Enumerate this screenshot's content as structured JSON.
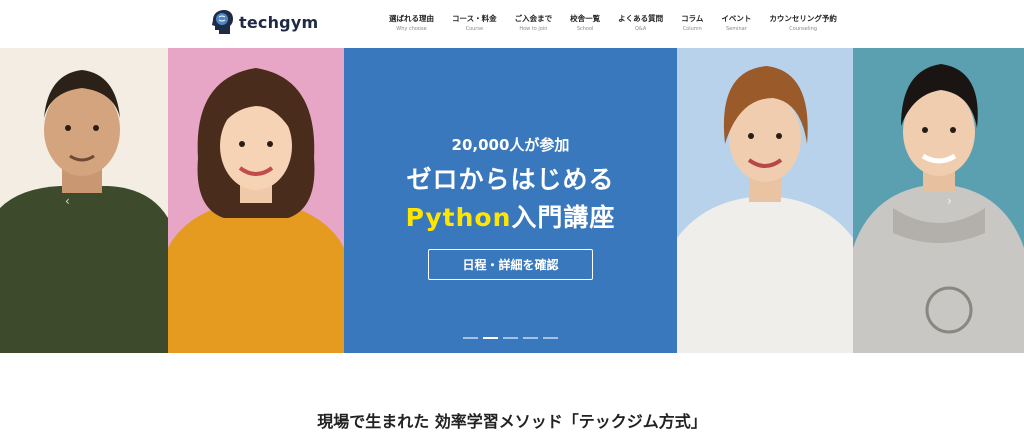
{
  "header": {
    "logo_text": "techgym",
    "nav": [
      {
        "jp": "選ばれる理由",
        "en": "Why choose"
      },
      {
        "jp": "コース・料金",
        "en": "Course"
      },
      {
        "jp": "ご入会まで",
        "en": "How to join"
      },
      {
        "jp": "校舎一覧",
        "en": "School"
      },
      {
        "jp": "よくある質問",
        "en": "Q&A"
      },
      {
        "jp": "コラム",
        "en": "Column"
      },
      {
        "jp": "イベント",
        "en": "Seminar"
      },
      {
        "jp": "カウンセリング予約",
        "en": "Counseling"
      }
    ]
  },
  "hero": {
    "sub": "20,000人が参加",
    "main1": "ゼロからはじめる",
    "highlight": "Python",
    "main2_rest": "入門講座",
    "cta": "日程・詳細を確認",
    "slides_total": 5,
    "active_slide": 2,
    "highlight_color": "#ffe600",
    "center_bg": "#3a78bd"
  },
  "section": {
    "title": "現場で生まれた 効率学習メソッド「テックジム方式」"
  }
}
